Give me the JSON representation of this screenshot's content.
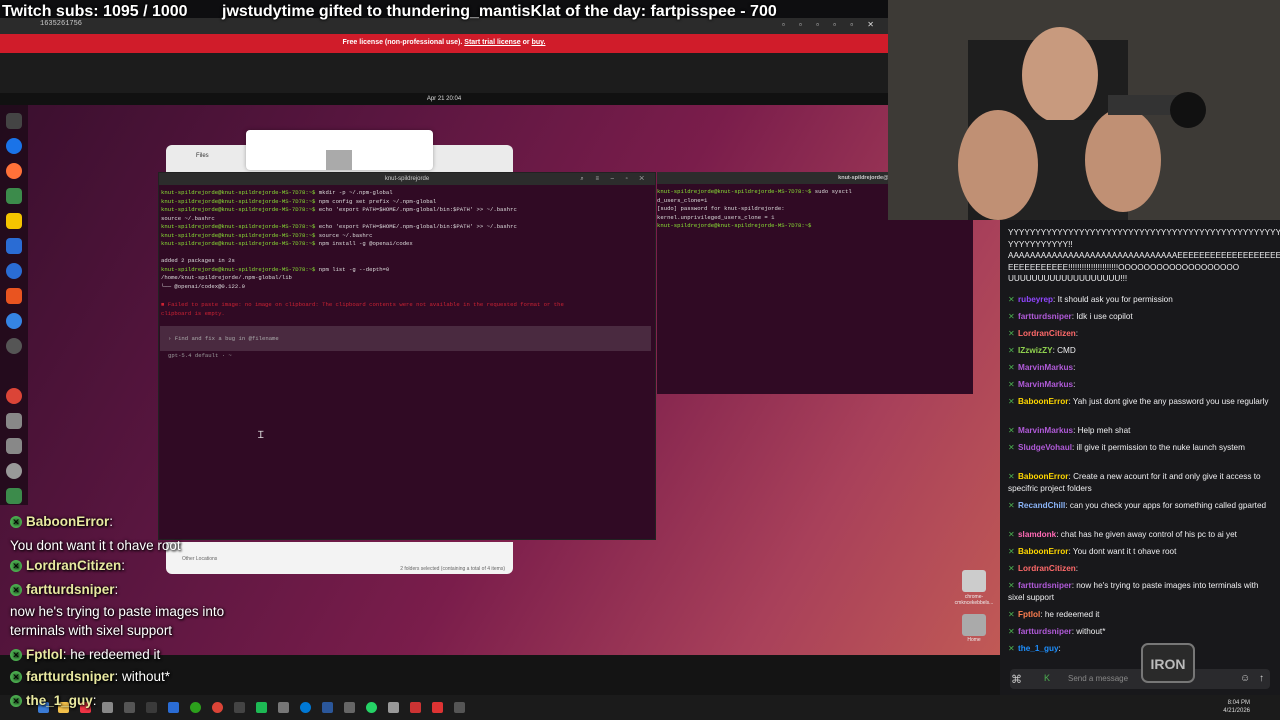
{
  "overlay_top": {
    "subs": "Twitch subs: 1095 / 1000",
    "gift": "jwstudytime gifted to thundering_mantisKlat of the day: fartpisspee - 700"
  },
  "browser": {
    "url_text": "1635261756",
    "license_text": "Free license (non-professional use).",
    "trial_link": "Start trial license",
    "or_text": "or",
    "buy_link": "buy."
  },
  "ubuntu": {
    "date": "Apr 21 20:04"
  },
  "files_window": {
    "title": "Files",
    "other_locations": "Other Locations",
    "selection_status": "2 folders selected (containing a total of 4 items)"
  },
  "terminal_main": {
    "title": "knut-spildrejorde",
    "lines": [
      {
        "prompt": "knut-spildrejorde@knut-spildrejorde-MS-7D78:~$",
        "cmd": " mkdir -p ~/.npm-global"
      },
      {
        "prompt": "knut-spildrejorde@knut-spildrejorde-MS-7D78:~$",
        "cmd": " npm config set prefix ~/.npm-global"
      },
      {
        "prompt": "knut-spildrejorde@knut-spildrejorde-MS-7D78:~$",
        "cmd": " echo 'export PATH=$HOME/.npm-global/bin:$PATH' >> ~/.bashrc"
      },
      {
        "prompt": "",
        "cmd": "source ~/.bashrc"
      },
      {
        "prompt": "knut-spildrejorde@knut-spildrejorde-MS-7D78:~$",
        "cmd": " echo 'export PATH=$HOME/.npm-global/bin:$PATH' >> ~/.bashrc"
      },
      {
        "prompt": "knut-spildrejorde@knut-spildrejorde-MS-7D78:~$",
        "cmd": " source ~/.bashrc"
      },
      {
        "prompt": "knut-spildrejorde@knut-spildrejorde-MS-7D78:~$",
        "cmd": " npm install -g @openai/codex"
      },
      {
        "prompt": "",
        "cmd": ""
      },
      {
        "prompt": "",
        "cmd": "added 2 packages in 2s"
      },
      {
        "prompt": "knut-spildrejorde@knut-spildrejorde-MS-7D78:~$",
        "cmd": " npm list -g --depth=0"
      },
      {
        "prompt": "",
        "cmd": "/home/knut-spildrejorde/.npm-global/lib"
      },
      {
        "prompt": "",
        "cmd": "└── @openai/codex@0.122.0"
      }
    ],
    "error_line1": "■ Failed to paste image: no image on clipboard: The clipboard contents were not available in the requested format or the",
    "error_line2": "clipboard is empty.",
    "input_placeholder": "› Find and fix a bug in @filename",
    "footer": "gpt-5.4 default · ~"
  },
  "terminal_2": {
    "title": "knut-spildrejorde@knut-spildrejorde-MS-7D78: ~",
    "lines": [
      {
        "prompt": "knut-spildrejorde@knut-spildrejorde-MS-7D78:~$",
        "cmd": " sudo sysctl"
      },
      {
        "prompt": "",
        "cmd": "d_users_clone=1"
      },
      {
        "prompt": "",
        "cmd": "[sudo] password for knut-spildrejorde:"
      },
      {
        "prompt": "",
        "cmd": "kernel.unprivileged_users_clone = 1"
      },
      {
        "prompt": "knut-spildrejorde@knut-spildrejorde-MS-7D78:~$",
        "cmd": " "
      }
    ]
  },
  "desktop_icons": {
    "chrome_label": "chrome-cmkncekebbels...",
    "home_label": "Home"
  },
  "overlay_chat": [
    {
      "name": "BaboonError",
      "text": ":"
    },
    {
      "name": "",
      "text": "You dont want it t ohave root"
    },
    {
      "name": "LordranCitizen",
      "text": ":"
    },
    {
      "name": "fartturdsniper",
      "text": ":"
    },
    {
      "name": "",
      "text": "now he's trying to paste images into"
    },
    {
      "name": "",
      "text": "terminals with sixel support"
    },
    {
      "name": "Fptlol",
      "text": ": he redeemed it"
    },
    {
      "name": "fartturdsniper",
      "text": ": without*"
    },
    {
      "name": "the_1_guy",
      "text": ":"
    }
  ],
  "twitch_chat": {
    "top_text1": "YYYYYYYYYYYYYYYYYYYYYYYYYYYYYYYYYYYYYYYYYYYYYYYYYYYY YYYYYYYYYYY!!",
    "top_text2": "AAAAAAAAAAAAAAAAAAAAAAAAAAAAAAAEEEEEEEEEEEEEEEEEEEEEEE EEEEEEEEEEE!!!!!!!!!!!!!!!!!!!!!!OOOOOOOOOOOOOOOOOOO UUUUUUUUUUUUUUUUUUU!!!",
    "messages": [
      {
        "name": "rubeyrep",
        "color": "#9146ff",
        "text": "It should ask you for permission"
      },
      {
        "name": "fartturdsniper",
        "color": "#b05ad8",
        "text": "Idk i use copilot"
      },
      {
        "name": "LordranCitizen",
        "color": "#ff6a6a",
        "text": ""
      },
      {
        "name": "IZzwizZY",
        "color": "#8fd14f",
        "text": "CMD"
      },
      {
        "name": "MarvinMarkus",
        "color": "#b05ad8",
        "text": ""
      },
      {
        "name": "MarvinMarkus",
        "color": "#b05ad8",
        "text": ""
      },
      {
        "name": "BaboonError",
        "color": "#ffd700",
        "text": "Yah just dont give the  any password you use regularly"
      },
      {
        "name": "MarvinMarkus",
        "color": "#b05ad8",
        "text": "Help meh shat"
      },
      {
        "name": "SludgeVohaul",
        "color": "#b05ad8",
        "text": "ill give it permission to the nuke launch system"
      },
      {
        "name": "BaboonError",
        "color": "#ffd700",
        "text": "Create a new acount for it and only give it access to specifric project folders"
      },
      {
        "name": "RecandChill",
        "color": "#8ab4f8",
        "text": "can you check your apps for something called gparted"
      },
      {
        "name": "slamdonk",
        "color": "#ff69b4",
        "text": "chat has he given away control of his pc to ai yet"
      },
      {
        "name": "BaboonError",
        "color": "#ffd700",
        "text": "You dont want it t ohave root"
      },
      {
        "name": "LordranCitizen",
        "color": "#ff6a6a",
        "text": ""
      },
      {
        "name": "fartturdsniper",
        "color": "#b05ad8",
        "text": "now he's trying to paste images into terminals with sixel support"
      },
      {
        "name": "Fptlol",
        "color": "#ff7f50",
        "text": "he redeemed it"
      },
      {
        "name": "fartturdsniper",
        "color": "#b05ad8",
        "text": "without*"
      },
      {
        "name": "the_1_guy",
        "color": "#1e90ff",
        "text": ""
      }
    ],
    "input_placeholder": "Send a message"
  },
  "logo_text": "IRON",
  "clock": {
    "time": "8:04 PM",
    "date": "4/21/2026"
  }
}
